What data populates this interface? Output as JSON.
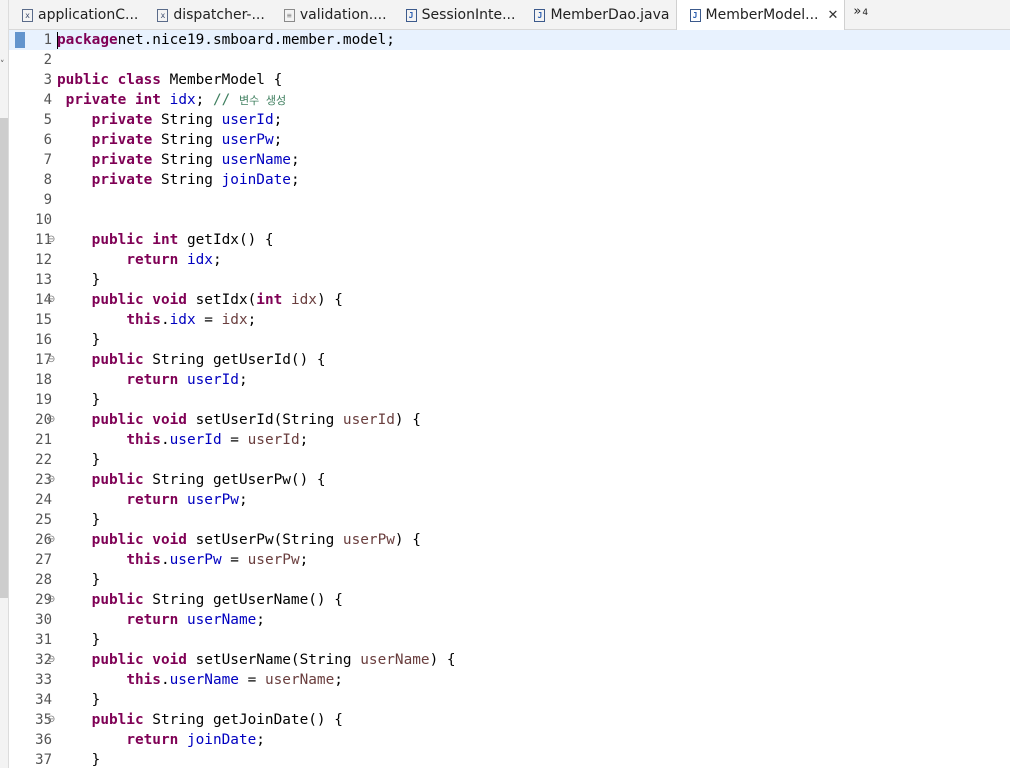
{
  "tabs": [
    {
      "label": "applicationC...",
      "icon": "xml-file-icon"
    },
    {
      "label": "dispatcher-...",
      "icon": "xml-file-icon"
    },
    {
      "label": "validation....",
      "icon": "text-file-icon"
    },
    {
      "label": "SessionInte...",
      "icon": "java-file-icon"
    },
    {
      "label": "MemberDao.java",
      "icon": "java-file-icon"
    },
    {
      "label": "MemberModel...",
      "icon": "java-file-icon",
      "active": true
    }
  ],
  "overflow": {
    "symbol": "»",
    "count": "4"
  },
  "colors": {
    "keyword": "#7f0055",
    "field": "#0000c0",
    "parameter": "#6a3e3e",
    "comment": "#3f7f5f",
    "current_line": "#e8f2fe",
    "tab_bar": "#f3f3f3"
  },
  "editor": {
    "lines": [
      {
        "n": "1",
        "fold": false,
        "tokens": [
          [
            "kw",
            "package"
          ],
          [
            "",
            "net.nice19.smboard.member.model;"
          ]
        ]
      },
      {
        "n": "2",
        "fold": false,
        "tokens": []
      },
      {
        "n": "3",
        "fold": false,
        "tokens": [
          [
            "kw",
            "public class"
          ],
          [
            "",
            " MemberModel {"
          ]
        ]
      },
      {
        "n": "4",
        "fold": false,
        "tokens": [
          [
            "",
            " "
          ],
          [
            "kw",
            "private int"
          ],
          [
            "",
            " "
          ],
          [
            "fld",
            "idx"
          ],
          [
            "",
            "; "
          ],
          [
            "cm",
            "// "
          ],
          [
            "cmko",
            "변수 생성"
          ]
        ]
      },
      {
        "n": "5",
        "fold": false,
        "tokens": [
          [
            "",
            "    "
          ],
          [
            "kw",
            "private"
          ],
          [
            "",
            " String "
          ],
          [
            "fld",
            "userId"
          ],
          [
            "",
            ";"
          ]
        ]
      },
      {
        "n": "6",
        "fold": false,
        "tokens": [
          [
            "",
            "    "
          ],
          [
            "kw",
            "private"
          ],
          [
            "",
            " String "
          ],
          [
            "fld",
            "userPw"
          ],
          [
            "",
            ";"
          ]
        ]
      },
      {
        "n": "7",
        "fold": false,
        "tokens": [
          [
            "",
            "    "
          ],
          [
            "kw",
            "private"
          ],
          [
            "",
            " String "
          ],
          [
            "fld",
            "userName"
          ],
          [
            "",
            ";"
          ]
        ]
      },
      {
        "n": "8",
        "fold": false,
        "tokens": [
          [
            "",
            "    "
          ],
          [
            "kw",
            "private"
          ],
          [
            "",
            " String "
          ],
          [
            "fld",
            "joinDate"
          ],
          [
            "",
            ";"
          ]
        ]
      },
      {
        "n": "9",
        "fold": false,
        "tokens": []
      },
      {
        "n": "10",
        "fold": false,
        "tokens": []
      },
      {
        "n": "11",
        "fold": true,
        "tokens": [
          [
            "",
            "    "
          ],
          [
            "kw",
            "public int"
          ],
          [
            "",
            " getIdx() {"
          ]
        ]
      },
      {
        "n": "12",
        "fold": false,
        "tokens": [
          [
            "",
            "        "
          ],
          [
            "kw",
            "return"
          ],
          [
            "",
            " "
          ],
          [
            "fld",
            "idx"
          ],
          [
            "",
            ";"
          ]
        ]
      },
      {
        "n": "13",
        "fold": false,
        "tokens": [
          [
            "",
            "    }"
          ]
        ]
      },
      {
        "n": "14",
        "fold": true,
        "tokens": [
          [
            "",
            "    "
          ],
          [
            "kw",
            "public void"
          ],
          [
            "",
            " setIdx("
          ],
          [
            "kw",
            "int"
          ],
          [
            "",
            " "
          ],
          [
            "prm",
            "idx"
          ],
          [
            "",
            ") {"
          ]
        ]
      },
      {
        "n": "15",
        "fold": false,
        "tokens": [
          [
            "",
            "        "
          ],
          [
            "kw",
            "this"
          ],
          [
            "",
            "."
          ],
          [
            "fld",
            "idx"
          ],
          [
            "",
            " = "
          ],
          [
            "prm",
            "idx"
          ],
          [
            "",
            ";"
          ]
        ]
      },
      {
        "n": "16",
        "fold": false,
        "tokens": [
          [
            "",
            "    }"
          ]
        ]
      },
      {
        "n": "17",
        "fold": true,
        "tokens": [
          [
            "",
            "    "
          ],
          [
            "kw",
            "public"
          ],
          [
            "",
            " String getUserId() {"
          ]
        ]
      },
      {
        "n": "18",
        "fold": false,
        "tokens": [
          [
            "",
            "        "
          ],
          [
            "kw",
            "return"
          ],
          [
            "",
            " "
          ],
          [
            "fld",
            "userId"
          ],
          [
            "",
            ";"
          ]
        ]
      },
      {
        "n": "19",
        "fold": false,
        "tokens": [
          [
            "",
            "    }"
          ]
        ]
      },
      {
        "n": "20",
        "fold": true,
        "tokens": [
          [
            "",
            "    "
          ],
          [
            "kw",
            "public void"
          ],
          [
            "",
            " setUserId(String "
          ],
          [
            "prm",
            "userId"
          ],
          [
            "",
            ") {"
          ]
        ]
      },
      {
        "n": "21",
        "fold": false,
        "tokens": [
          [
            "",
            "        "
          ],
          [
            "kw",
            "this"
          ],
          [
            "",
            "."
          ],
          [
            "fld",
            "userId"
          ],
          [
            "",
            " = "
          ],
          [
            "prm",
            "userId"
          ],
          [
            "",
            ";"
          ]
        ]
      },
      {
        "n": "22",
        "fold": false,
        "tokens": [
          [
            "",
            "    }"
          ]
        ]
      },
      {
        "n": "23",
        "fold": true,
        "tokens": [
          [
            "",
            "    "
          ],
          [
            "kw",
            "public"
          ],
          [
            "",
            " String getUserPw() {"
          ]
        ]
      },
      {
        "n": "24",
        "fold": false,
        "tokens": [
          [
            "",
            "        "
          ],
          [
            "kw",
            "return"
          ],
          [
            "",
            " "
          ],
          [
            "fld",
            "userPw"
          ],
          [
            "",
            ";"
          ]
        ]
      },
      {
        "n": "25",
        "fold": false,
        "tokens": [
          [
            "",
            "    }"
          ]
        ]
      },
      {
        "n": "26",
        "fold": true,
        "tokens": [
          [
            "",
            "    "
          ],
          [
            "kw",
            "public void"
          ],
          [
            "",
            " setUserPw(String "
          ],
          [
            "prm",
            "userPw"
          ],
          [
            "",
            ") {"
          ]
        ]
      },
      {
        "n": "27",
        "fold": false,
        "tokens": [
          [
            "",
            "        "
          ],
          [
            "kw",
            "this"
          ],
          [
            "",
            "."
          ],
          [
            "fld",
            "userPw"
          ],
          [
            "",
            " = "
          ],
          [
            "prm",
            "userPw"
          ],
          [
            "",
            ";"
          ]
        ]
      },
      {
        "n": "28",
        "fold": false,
        "tokens": [
          [
            "",
            "    }"
          ]
        ]
      },
      {
        "n": "29",
        "fold": true,
        "tokens": [
          [
            "",
            "    "
          ],
          [
            "kw",
            "public"
          ],
          [
            "",
            " String getUserName() {"
          ]
        ]
      },
      {
        "n": "30",
        "fold": false,
        "tokens": [
          [
            "",
            "        "
          ],
          [
            "kw",
            "return"
          ],
          [
            "",
            " "
          ],
          [
            "fld",
            "userName"
          ],
          [
            "",
            ";"
          ]
        ]
      },
      {
        "n": "31",
        "fold": false,
        "tokens": [
          [
            "",
            "    }"
          ]
        ]
      },
      {
        "n": "32",
        "fold": true,
        "tokens": [
          [
            "",
            "    "
          ],
          [
            "kw",
            "public void"
          ],
          [
            "",
            " setUserName(String "
          ],
          [
            "prm",
            "userName"
          ],
          [
            "",
            ") {"
          ]
        ]
      },
      {
        "n": "33",
        "fold": false,
        "tokens": [
          [
            "",
            "        "
          ],
          [
            "kw",
            "this"
          ],
          [
            "",
            "."
          ],
          [
            "fld",
            "userName"
          ],
          [
            "",
            " = "
          ],
          [
            "prm",
            "userName"
          ],
          [
            "",
            ";"
          ]
        ]
      },
      {
        "n": "34",
        "fold": false,
        "tokens": [
          [
            "",
            "    }"
          ]
        ]
      },
      {
        "n": "35",
        "fold": true,
        "tokens": [
          [
            "",
            "    "
          ],
          [
            "kw",
            "public"
          ],
          [
            "",
            " String getJoinDate() {"
          ]
        ]
      },
      {
        "n": "36",
        "fold": false,
        "tokens": [
          [
            "",
            "        "
          ],
          [
            "kw",
            "return"
          ],
          [
            "",
            " "
          ],
          [
            "fld",
            "joinDate"
          ],
          [
            "",
            ";"
          ]
        ]
      },
      {
        "n": "37",
        "fold": false,
        "tokens": [
          [
            "",
            "    }"
          ]
        ]
      }
    ]
  }
}
